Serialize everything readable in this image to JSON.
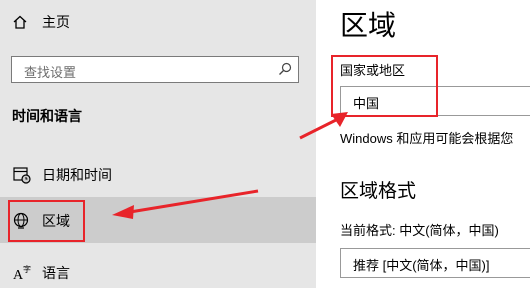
{
  "sidebar": {
    "home_label": "主页",
    "search_placeholder": "查找设置",
    "section_title": "时间和语言",
    "items": [
      {
        "label": "日期和时间",
        "icon": "calendar-clock-icon"
      },
      {
        "label": "区域",
        "icon": "globe-region-icon",
        "selected": true
      },
      {
        "label": "语言",
        "icon": "language-icon"
      }
    ]
  },
  "main": {
    "title": "区域",
    "country_label": "国家或地区",
    "country_value": "中国",
    "country_desc": "Windows 和应用可能会根据您",
    "format_heading": "区域格式",
    "current_format": "当前格式: 中文(简体，中国)",
    "format_value": "推荐 [中文(简体，中国)]"
  },
  "colors": {
    "sidebar_bg": "#e6e6e6",
    "selected_bg": "#cccccc",
    "annotation_red": "#e8242a"
  }
}
